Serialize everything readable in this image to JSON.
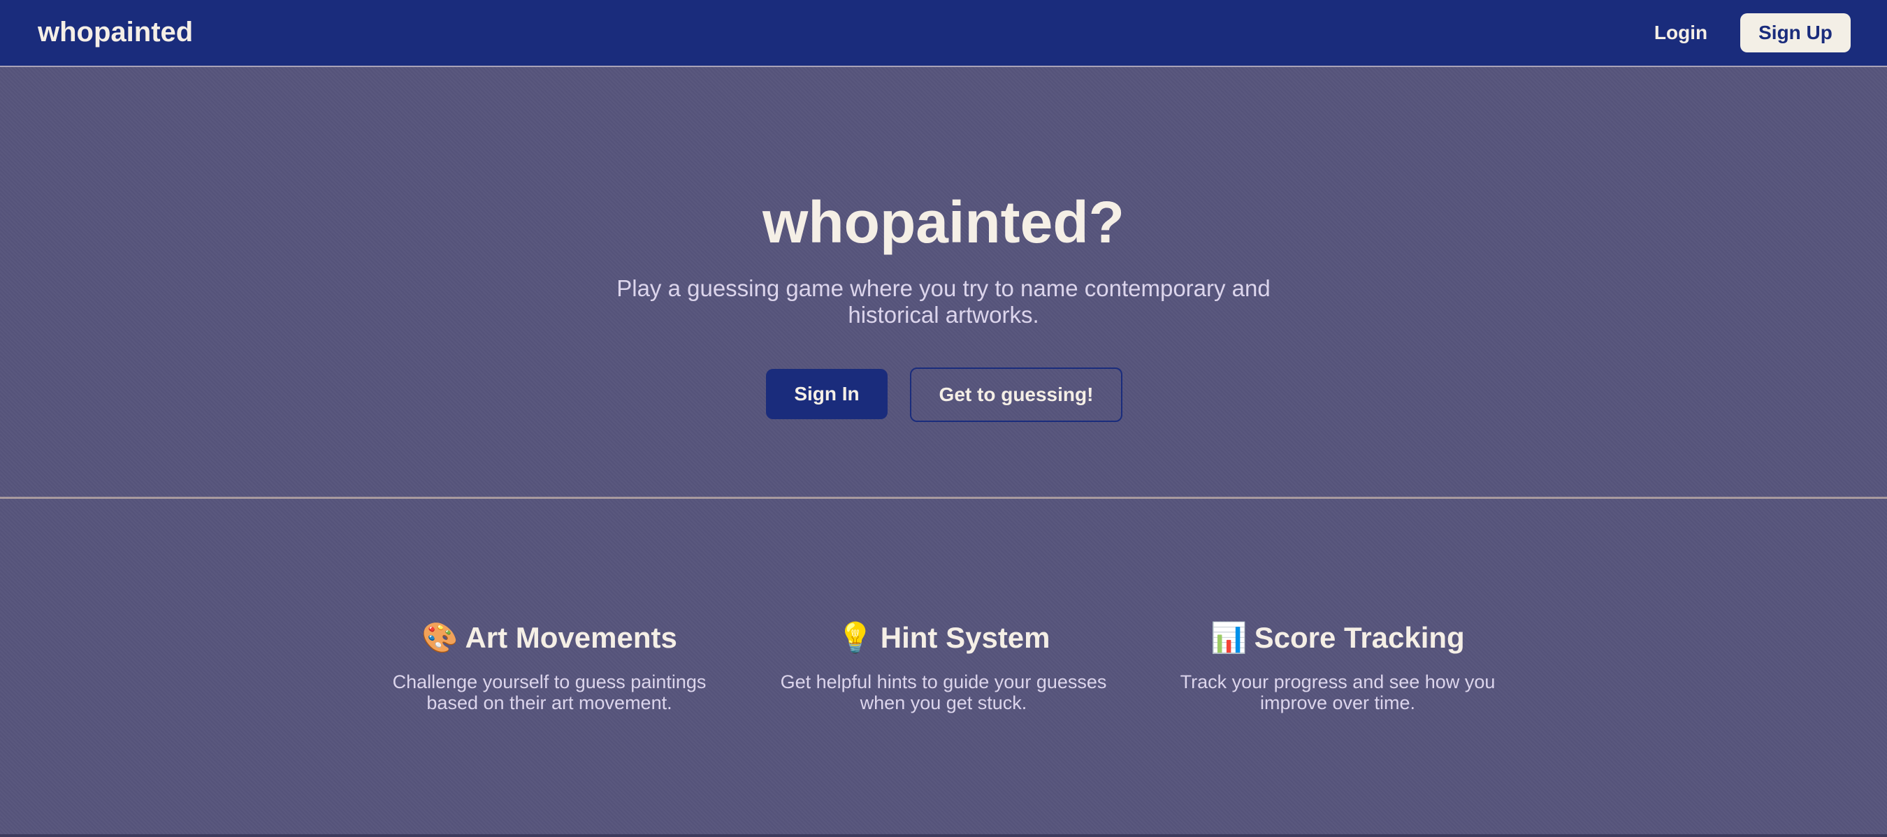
{
  "nav": {
    "brand": "whopainted",
    "login_label": "Login",
    "signup_label": "Sign Up"
  },
  "hero": {
    "title": "whopainted?",
    "subtitle": "Play a guessing game where you try to name contemporary and historical artworks.",
    "primary_button": "Sign In",
    "secondary_button": "Get to guessing!"
  },
  "features": [
    {
      "emoji": "🎨",
      "icon": "palette-icon",
      "title": "Art Movements",
      "description": "Challenge yourself to guess paintings based on their art movement."
    },
    {
      "emoji": "💡",
      "icon": "lightbulb-icon",
      "title": "Hint System",
      "description": "Get helpful hints to guide your guesses when you get stuck."
    },
    {
      "emoji": "📊",
      "icon": "bar-chart-icon",
      "title": "Score Tracking",
      "description": "Track your progress and see how you improve over time."
    }
  ],
  "colors": {
    "nav_background": "#1a2c7c",
    "page_background": "#57557c",
    "text_primary": "#f5efe6",
    "text_secondary": "#dcd5ec",
    "divider": "#a89a9e"
  }
}
